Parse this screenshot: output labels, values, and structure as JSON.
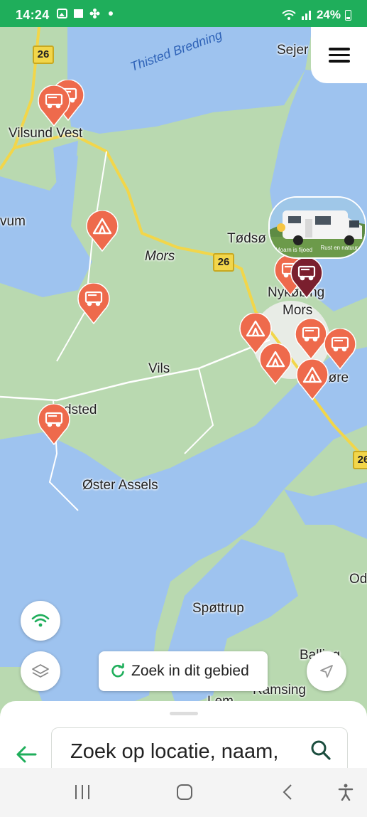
{
  "status": {
    "time": "14:24",
    "battery": "24%"
  },
  "map": {
    "water_label": "Thisted Bredning",
    "places": [
      {
        "id": "sejer",
        "text": "Sejer"
      },
      {
        "id": "vilsund",
        "text": "Vilsund Vest"
      },
      {
        "id": "vum",
        "text": "vum"
      },
      {
        "id": "mors",
        "text": "Mors"
      },
      {
        "id": "todso",
        "text": "Tødsø"
      },
      {
        "id": "nykobing",
        "text": "Nykøbing"
      },
      {
        "id": "mors2",
        "text": "Mors"
      },
      {
        "id": "vils",
        "text": "Vils"
      },
      {
        "id": "dsted",
        "text": "dsted"
      },
      {
        "id": "gejlsore",
        "text": "Ge  øre"
      },
      {
        "id": "oster",
        "text": "Øster Assels"
      },
      {
        "id": "sp",
        "text": "Spøttrup"
      },
      {
        "id": "od",
        "text": "Od"
      },
      {
        "id": "balling",
        "text": "Balling"
      },
      {
        "id": "ramsing",
        "text": "Ramsing"
      },
      {
        "id": "lem",
        "text": "Lem"
      }
    ],
    "road_numbers": [
      "26",
      "26",
      "26"
    ],
    "pins": [
      {
        "kind": "camper",
        "color": "#ee6a4c"
      },
      {
        "kind": "camper",
        "color": "#ee6a4c"
      },
      {
        "kind": "tent",
        "color": "#ee6a4c"
      },
      {
        "kind": "camper",
        "color": "#ee6a4c"
      },
      {
        "kind": "camper",
        "color": "#ee6a4c"
      },
      {
        "kind": "tent",
        "color": "#ee6a4c"
      },
      {
        "kind": "tent",
        "color": "#ee6a4c"
      },
      {
        "kind": "camper",
        "color": "#ee6a4c"
      },
      {
        "kind": "camper",
        "color": "#ee6a4c"
      },
      {
        "kind": "tent",
        "color": "#ee6a4c"
      },
      {
        "kind": "camper",
        "color": "#ee6a4c"
      },
      {
        "kind": "camper-selected",
        "color": "#7a1f2e"
      }
    ],
    "photo": {
      "caption_left": "Moarn is fijoed",
      "caption_right": "Rust en natuur"
    }
  },
  "controls": {
    "search_area_label": "Zoek in dit gebied",
    "menu_icon": "hamburger-menu-icon",
    "wifi_icon": "wifi-icon",
    "layers_icon": "layers-icon",
    "locate_icon": "navigation-arrow-icon"
  },
  "sheet": {
    "search_placeholder": "Zoek op locatie, naam,"
  },
  "colors": {
    "brand_green": "#1fae5b",
    "pin_orange": "#ee6a4c",
    "pin_selected": "#7a1f2e",
    "water": "#9ec3ef",
    "land": "#b9d9b0"
  }
}
